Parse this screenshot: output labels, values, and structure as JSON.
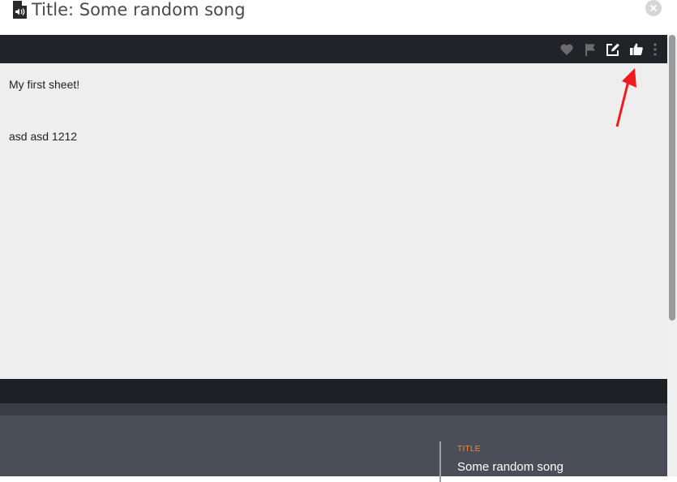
{
  "dialog": {
    "title": "Title: Some random song",
    "icon": "audio-file-icon",
    "close_icon": "close-icon"
  },
  "toolbar": {
    "icons": [
      "heart-icon",
      "flag-icon",
      "edit-icon",
      "thumbs-up-icon",
      "more-vertical-icon"
    ],
    "icon_color_inactive": "#6b6b6b",
    "icon_color_active": "#ffffff"
  },
  "sheet": {
    "lines": [
      "My first sheet!",
      "asd asd 1212"
    ]
  },
  "details": {
    "title_label": "TITLE",
    "title_value": "Some random song"
  },
  "annotation": {
    "type": "arrow",
    "color": "#ee1c1c"
  }
}
